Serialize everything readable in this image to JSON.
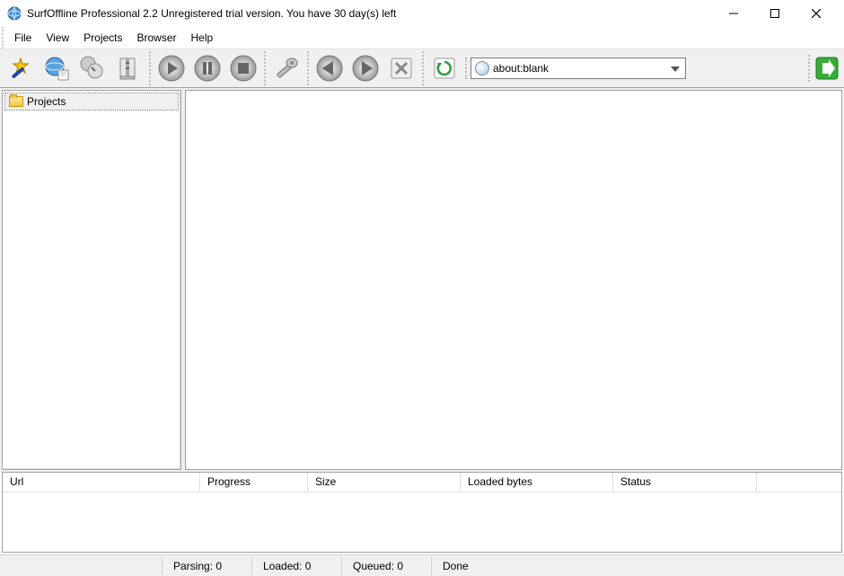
{
  "title": "SurfOffline Professional 2.2  Unregistered trial version. You have 30 day(s) left",
  "menu": [
    "File",
    "View",
    "Projects",
    "Browser",
    "Help"
  ],
  "toolbar": {
    "wizard": "wizard",
    "new_project": "new-project",
    "copy": "copy",
    "archive": "archive",
    "play": "play",
    "pause": "pause",
    "stop": "stop",
    "settings": "settings",
    "back": "back",
    "forward": "forward",
    "cancel": "cancel",
    "refresh": "refresh",
    "go": "go"
  },
  "url_value": "about:blank",
  "sidebar": {
    "root_label": "Projects"
  },
  "downloads": {
    "columns": [
      "Url",
      "Progress",
      "Size",
      "Loaded bytes",
      "Status"
    ]
  },
  "statusbar": {
    "parsing": "Parsing: 0",
    "loaded": "Loaded: 0",
    "queued": "Queued: 0",
    "state": "Done"
  }
}
